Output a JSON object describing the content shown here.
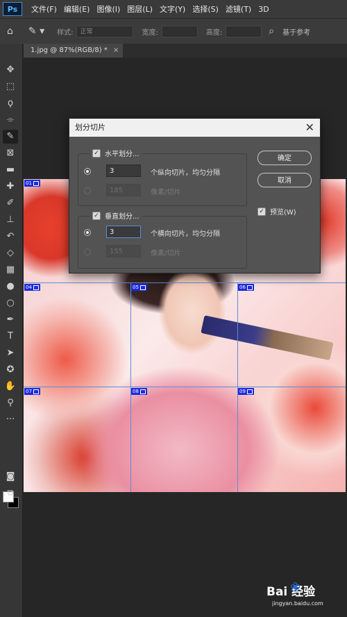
{
  "menubar": {
    "logo": "Ps",
    "items": [
      "文件(F)",
      "编辑(E)",
      "图像(I)",
      "图层(L)",
      "文字(Y)",
      "选择(S)",
      "滤镜(T)",
      "3D"
    ]
  },
  "options": {
    "style_label": "样式:",
    "style_value": "正常",
    "width_label": "宽度:",
    "height_label": "高度:",
    "slices_label": "基于参考"
  },
  "document": {
    "tab_title": "1.jpg @ 87%(RGB/8) *",
    "tab_close": "×"
  },
  "slice_tags": [
    "01",
    "04",
    "05",
    "06",
    "07",
    "08",
    "09"
  ],
  "dialog": {
    "title": "划分切片",
    "close": "✕",
    "horizontal": {
      "checkbox_label": "水平划分...",
      "checked": true,
      "count_value": "3",
      "count_suffix": "个纵向切片，均匀分隔",
      "pixels_value": "185",
      "pixels_suffix": "像素/切片"
    },
    "vertical": {
      "checkbox_label": "垂直划分...",
      "checked": true,
      "count_value": "3",
      "count_suffix": "个横向切片，均匀分隔",
      "pixels_value": "155",
      "pixels_suffix": "像素/切片"
    },
    "ok_label": "确定",
    "cancel_label": "取消",
    "preview_label": "预览(W)",
    "preview_checked": true
  },
  "watermark": {
    "brand": "Bai 经验",
    "url": "jingyan.baidu.com"
  },
  "colors": {
    "foreground": "#ffffff",
    "background": "#000000",
    "slice_line": "#5f8bd8",
    "slice_tag": "#1d2bdc"
  },
  "icons": [
    "home-icon",
    "brush-preset-icon",
    "search-icon",
    "move-tool-icon",
    "marquee-tool-icon",
    "lasso-tool-icon",
    "quick-select-tool-icon",
    "slice-tool-icon",
    "frame-tool-icon",
    "ruler-tool-icon",
    "healing-tool-icon",
    "brush-tool-icon",
    "stamp-tool-icon",
    "history-brush-icon",
    "eraser-tool-icon",
    "gradient-tool-icon",
    "blur-tool-icon",
    "dodge-tool-icon",
    "pen-tool-icon",
    "type-tool-icon",
    "path-select-icon",
    "shape-tool-icon",
    "hand-tool-icon",
    "zoom-tool-icon",
    "more-tools-icon",
    "quick-mask-icon",
    "screen-mode-icon"
  ]
}
